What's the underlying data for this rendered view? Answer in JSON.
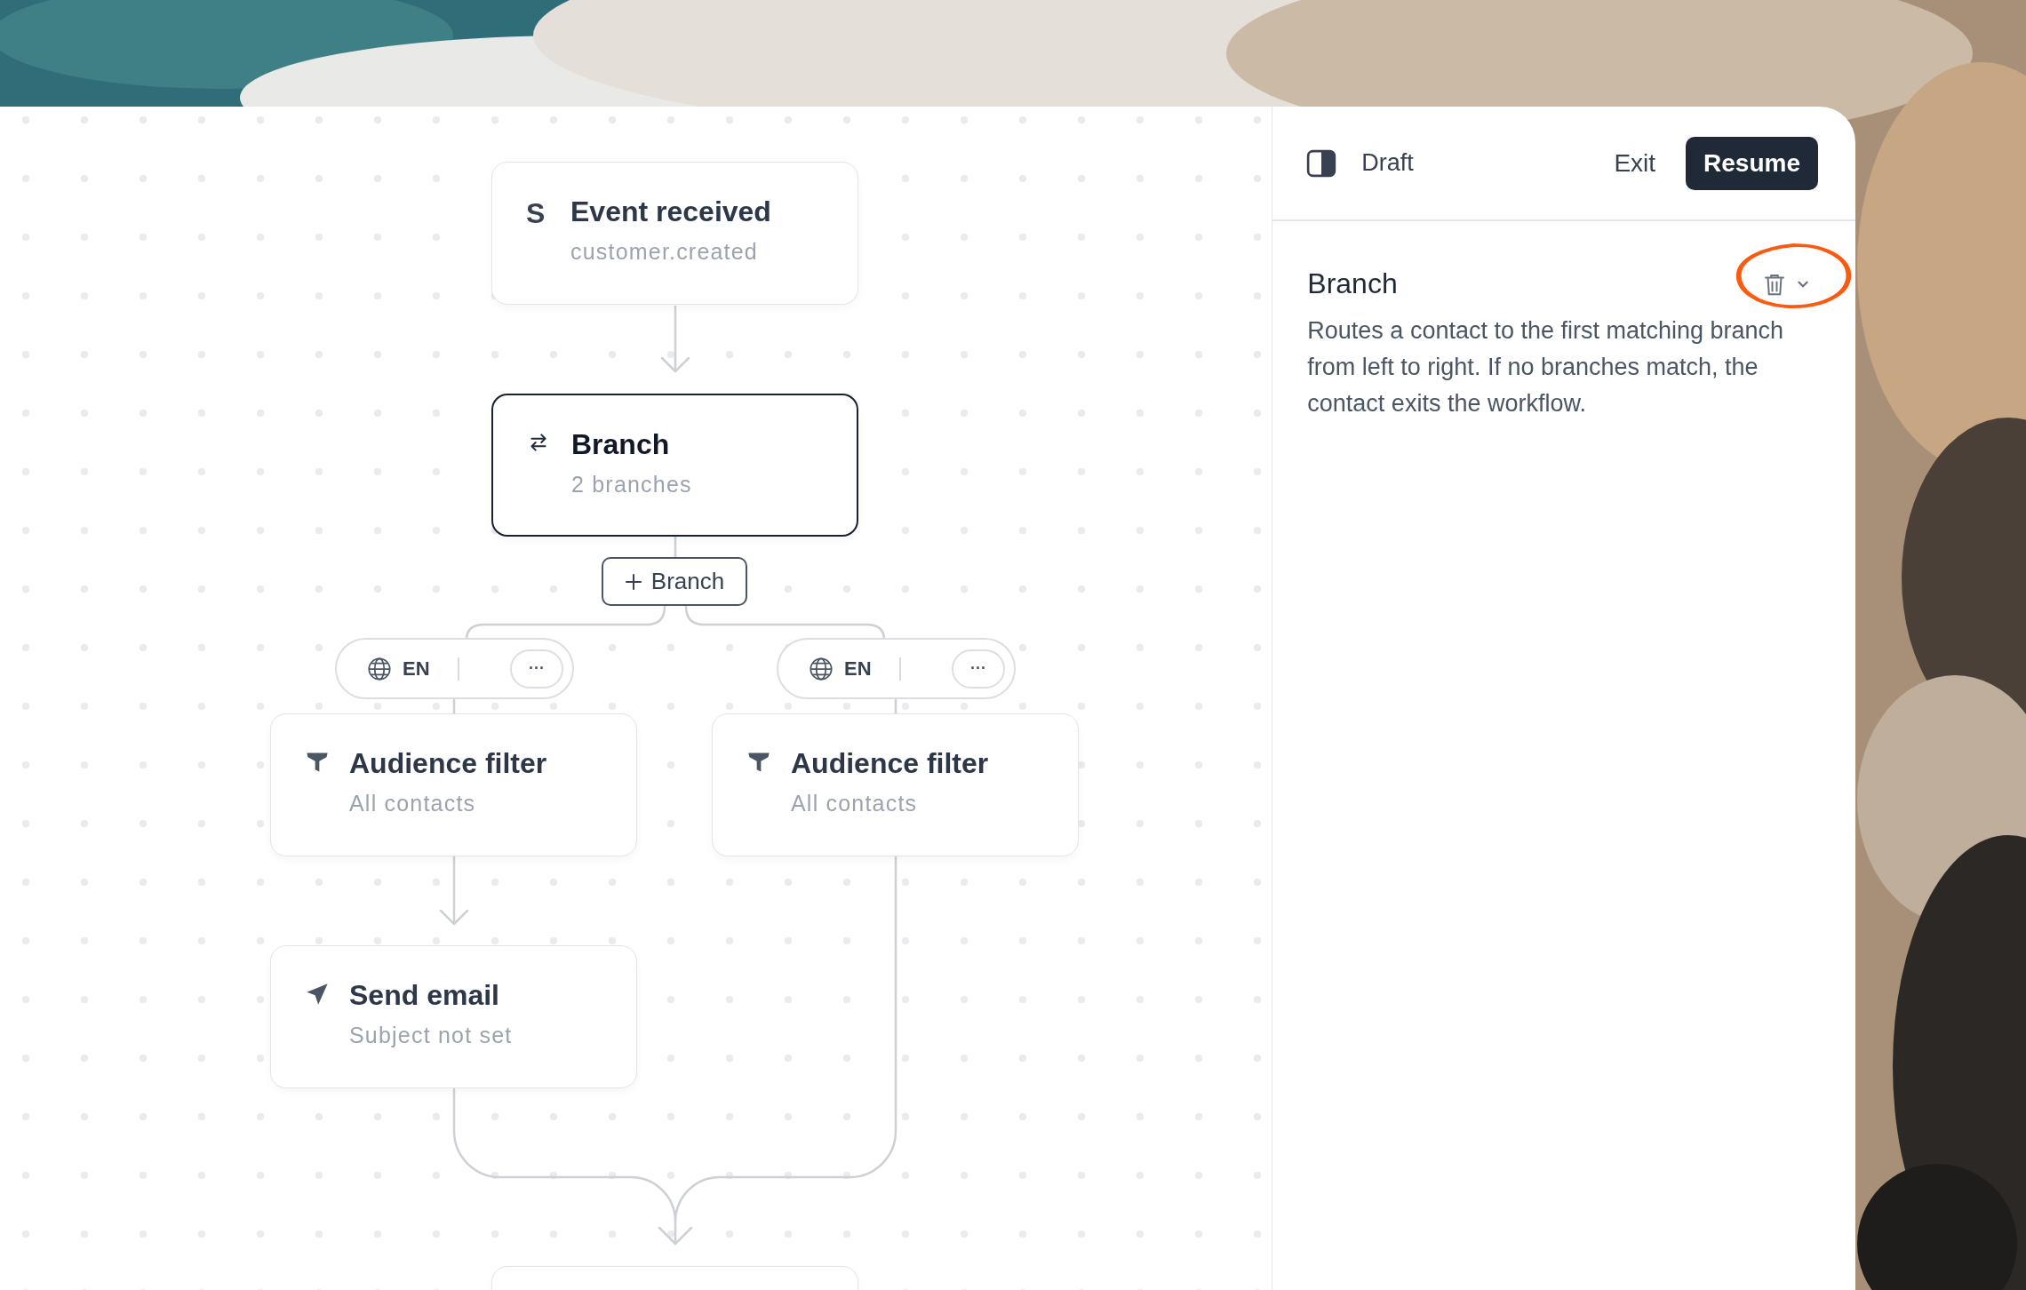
{
  "toolbar": {
    "status": "Draft",
    "exit": "Exit",
    "resume": "Resume"
  },
  "flow": {
    "trigger": {
      "kind": "trigger",
      "badge": "S",
      "title": "Event received",
      "subtitle": "customer.created",
      "selected": false
    },
    "branch": {
      "kind": "branch",
      "title": "Branch",
      "subtitle": "2 branches",
      "selected": true
    },
    "add_button": "Branch",
    "branches": [
      {
        "language": "EN",
        "menu": "···",
        "steps": [
          {
            "kind": "filter",
            "title": "Audience filter",
            "subtitle": "All contacts",
            "selected": false
          },
          {
            "kind": "email",
            "title": "Send email",
            "subtitle": "Subject not set",
            "selected": false
          }
        ]
      },
      {
        "language": "EN",
        "menu": "···",
        "steps": [
          {
            "kind": "filter",
            "title": "Audience filter",
            "subtitle": "All contacts",
            "selected": false
          }
        ]
      }
    ]
  },
  "panel": {
    "title": "Branch",
    "description": "Routes a contact to the first matching branch from left to right. If no branches match, the contact exits the workflow.",
    "actions_circled": true
  }
}
